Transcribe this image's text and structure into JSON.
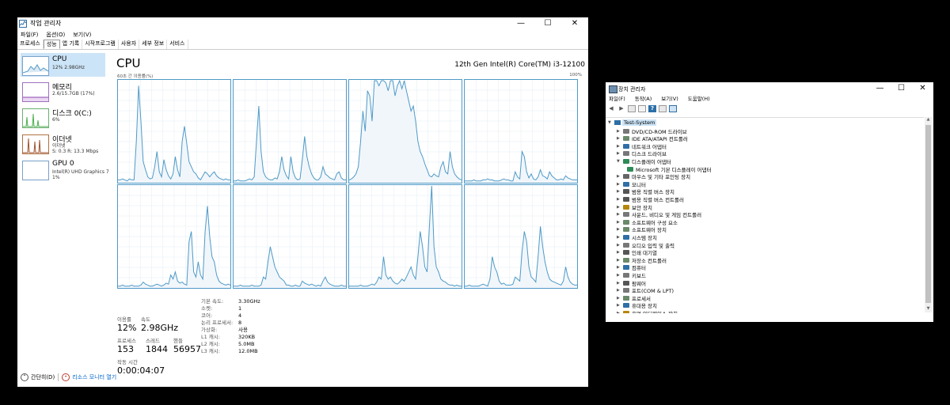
{
  "task_manager": {
    "title": "작업 관리자",
    "menu": [
      "파일(F)",
      "옵션(O)",
      "보기(V)"
    ],
    "tabs": [
      "프로세스",
      "성능",
      "앱 기록",
      "시작프로그램",
      "사용자",
      "세부 정보",
      "서비스"
    ],
    "active_tab": "성능",
    "sidebar": [
      {
        "name": "CPU",
        "sub": "12% 2.98GHz",
        "color": "#4f9ac7"
      },
      {
        "name": "메모리",
        "sub": "2.6/15.7GB (17%)",
        "color": "#8e44ad"
      },
      {
        "name": "디스크 0(C:)",
        "sub": "6%",
        "color": "#4caf50"
      },
      {
        "name": "이더넷",
        "sub": "이더넷",
        "sub2": "S: 0.3  R: 13.3 Mbps",
        "color": "#a0522d"
      },
      {
        "name": "GPU 0",
        "sub": "Intel(R) UHD Graphics 7",
        "sub2": "1%",
        "color": "#4f9ac7"
      }
    ],
    "cpu_title": "CPU",
    "cpu_model": "12th Gen Intel(R) Core(TM) i3-12100",
    "graph_label": "60초 간 이용률(%)",
    "graph_max": "100%",
    "stats": {
      "utilization_label": "이용률",
      "utilization": "12%",
      "speed_label": "속도",
      "speed": "2.98GHz",
      "processes_label": "프로세스",
      "processes": "153",
      "threads_label": "스레드",
      "threads": "1844",
      "handles_label": "핸들",
      "handles": "56957",
      "uptime_label": "작동 시간",
      "uptime": "0:00:04:07"
    },
    "specs": [
      {
        "k": "기본 속도:",
        "v": "3.30GHz"
      },
      {
        "k": "소켓:",
        "v": "1"
      },
      {
        "k": "코어:",
        "v": "4"
      },
      {
        "k": "논리 프로세서:",
        "v": "8"
      },
      {
        "k": "가상화:",
        "v": "사용"
      },
      {
        "k": "L1 캐시:",
        "v": "320KB"
      },
      {
        "k": "L2 캐시:",
        "v": "5.0MB"
      },
      {
        "k": "L3 캐시:",
        "v": "12.0MB"
      }
    ],
    "footer": {
      "simple": "간단히(D)",
      "resource_monitor": "리소스 모니터 열기"
    }
  },
  "device_manager": {
    "title": "장치 관리자",
    "menu": [
      "파일(F)",
      "동작(A)",
      "보기(V)",
      "도움말(H)"
    ],
    "root": "Test-System",
    "items": [
      {
        "label": "DVD/CD-ROM 드라이브",
        "color": "#777"
      },
      {
        "label": "IDE ATA/ATAPI 컨트롤러",
        "color": "#6a8a6a"
      },
      {
        "label": "네트워크 어댑터",
        "color": "#2e6fa7"
      },
      {
        "label": "디스크 드라이브",
        "color": "#777"
      },
      {
        "label": "디스플레이 어댑터",
        "color": "#2e8b57",
        "expanded": true
      },
      {
        "label": "Microsoft 기본 디스플레이 어댑터",
        "color": "#2e8b57",
        "child": true
      },
      {
        "label": "마우스 및 기타 포인팅 장치",
        "color": "#666"
      },
      {
        "label": "모니터",
        "color": "#2e6fa7"
      },
      {
        "label": "범용 직렬 버스 장치",
        "color": "#555"
      },
      {
        "label": "범용 직렬 버스 컨트롤러",
        "color": "#555"
      },
      {
        "label": "보안 장치",
        "color": "#b8860b"
      },
      {
        "label": "사운드, 비디오 및 게임 컨트롤러",
        "color": "#777"
      },
      {
        "label": "소프트웨어 구성 요소",
        "color": "#6a8a6a"
      },
      {
        "label": "소프트웨어 장치",
        "color": "#6a8a6a"
      },
      {
        "label": "시스템 장치",
        "color": "#2e6fa7"
      },
      {
        "label": "오디오 입력 및 출력",
        "color": "#777"
      },
      {
        "label": "인쇄 대기열",
        "color": "#555"
      },
      {
        "label": "저장소 컨트롤러",
        "color": "#6a8a6a"
      },
      {
        "label": "컴퓨터",
        "color": "#2e6fa7"
      },
      {
        "label": "키보드",
        "color": "#777"
      },
      {
        "label": "펌웨어",
        "color": "#555"
      },
      {
        "label": "포트(COM & LPT)",
        "color": "#777"
      },
      {
        "label": "프로세서",
        "color": "#6a8a6a"
      },
      {
        "label": "휴대용 장치",
        "color": "#2e6fa7"
      },
      {
        "label": "휴먼 인터페이스 장치",
        "color": "#b8860b"
      }
    ]
  },
  "core_graphs": [
    [
      2,
      2,
      3,
      2,
      1,
      3,
      2,
      2,
      40,
      95,
      60,
      20,
      12,
      5,
      3,
      4,
      15,
      30,
      10,
      5,
      22,
      12,
      6,
      3,
      8,
      25,
      12,
      5,
      40,
      55,
      38,
      20,
      15,
      10,
      8,
      4,
      2,
      6,
      10,
      8,
      5,
      8,
      10,
      6,
      4,
      3,
      2,
      3,
      2,
      2
    ],
    [
      1,
      1,
      2,
      1,
      1,
      1,
      2,
      3,
      2,
      5,
      40,
      75,
      30,
      10,
      5,
      3,
      2,
      2,
      4,
      3,
      10,
      25,
      12,
      6,
      3,
      25,
      10,
      4,
      2,
      3,
      22,
      45,
      25,
      15,
      8,
      4,
      2,
      2,
      5,
      15,
      8,
      6,
      4,
      3,
      2,
      8,
      10,
      4,
      2,
      2
    ],
    [
      2,
      3,
      5,
      8,
      15,
      40,
      70,
      50,
      90,
      85,
      60,
      100,
      100,
      95,
      100,
      100,
      98,
      90,
      100,
      100,
      85,
      95,
      100,
      92,
      100,
      90,
      80,
      70,
      75,
      60,
      40,
      30,
      25,
      18,
      12,
      6,
      5,
      8,
      6,
      5,
      15,
      20,
      10,
      8,
      30,
      15,
      8,
      5,
      3,
      2
    ],
    [
      1,
      1,
      1,
      1,
      2,
      1,
      1,
      1,
      2,
      2,
      3,
      2,
      2,
      1,
      1,
      1,
      2,
      3,
      2,
      2,
      1,
      1,
      10,
      5,
      3,
      30,
      25,
      10,
      4,
      8,
      3,
      2,
      5,
      12,
      6,
      5,
      3,
      10,
      6,
      4,
      2,
      2,
      3,
      2,
      6,
      4,
      3,
      2,
      2,
      2
    ],
    [
      1,
      1,
      2,
      1,
      1,
      1,
      2,
      1,
      1,
      1,
      2,
      5,
      3,
      2,
      1,
      1,
      2,
      3,
      2,
      1,
      2,
      4,
      3,
      12,
      8,
      15,
      6,
      4,
      5,
      3,
      2,
      45,
      55,
      15,
      10,
      25,
      12,
      8,
      55,
      80,
      50,
      30,
      25,
      12,
      6,
      4,
      3,
      2,
      3,
      2
    ],
    [
      1,
      1,
      1,
      2,
      1,
      1,
      1,
      1,
      2,
      1,
      1,
      1,
      2,
      10,
      8,
      25,
      40,
      30,
      20,
      15,
      10,
      8,
      6,
      2,
      2,
      1,
      1,
      2,
      1,
      1,
      6,
      4,
      3,
      2,
      3,
      2,
      1,
      2,
      1,
      6,
      10,
      5,
      3,
      2,
      1,
      1,
      1,
      2,
      1,
      1
    ],
    [
      1,
      1,
      1,
      1,
      1,
      2,
      1,
      1,
      1,
      2,
      3,
      2,
      5,
      10,
      8,
      30,
      12,
      8,
      10,
      6,
      4,
      3,
      5,
      8,
      6,
      10,
      15,
      20,
      12,
      8,
      30,
      55,
      40,
      20,
      15,
      60,
      100,
      40,
      20,
      15,
      8,
      6,
      5,
      3,
      2,
      2,
      1,
      2,
      1,
      1
    ],
    [
      1,
      1,
      2,
      1,
      1,
      1,
      1,
      2,
      3,
      2,
      1,
      8,
      30,
      20,
      15,
      6,
      3,
      4,
      2,
      2,
      2,
      3,
      10,
      8,
      6,
      35,
      55,
      45,
      20,
      10,
      8,
      5,
      30,
      60,
      40,
      25,
      15,
      8,
      6,
      5,
      4,
      3,
      2,
      6,
      20,
      10,
      5,
      3,
      2,
      2
    ]
  ]
}
